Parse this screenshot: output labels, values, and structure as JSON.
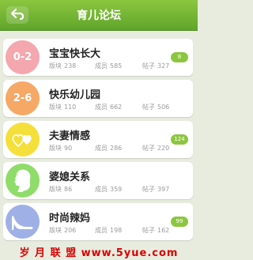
{
  "header": {
    "title": "育儿论坛"
  },
  "forums": [
    {
      "icon": "bubble-0-2-icon",
      "icon_text": "0-2",
      "color": "#f4a7ae",
      "name": "宝宝快长大",
      "stats": [
        {
          "label": "版块",
          "value": "238"
        },
        {
          "label": "成员",
          "value": "585"
        },
        {
          "label": "帖子",
          "value": "327"
        }
      ],
      "count": "8"
    },
    {
      "icon": "bubble-2-6-icon",
      "icon_text": "2-6",
      "color": "#f6a866",
      "name": "快乐幼儿园",
      "stats": [
        {
          "label": "版块",
          "value": "110"
        },
        {
          "label": "成员",
          "value": "662"
        },
        {
          "label": "帖子",
          "value": "506"
        }
      ],
      "count": ""
    },
    {
      "icon": "hearts-icon",
      "icon_text": "",
      "color": "#f5df3a",
      "name": "夫妻情感",
      "stats": [
        {
          "label": "版块",
          "value": "90"
        },
        {
          "label": "成员",
          "value": "286"
        },
        {
          "label": "帖子",
          "value": "220"
        }
      ],
      "count": "124"
    },
    {
      "icon": "woman-profile-icon",
      "icon_text": "",
      "color": "#8fdc6a",
      "name": "婆媳关系",
      "stats": [
        {
          "label": "版块",
          "value": "86"
        },
        {
          "label": "成员",
          "value": "359"
        },
        {
          "label": "帖子",
          "value": "397"
        }
      ],
      "count": ""
    },
    {
      "icon": "high-heel-icon",
      "icon_text": "",
      "color": "#9fb0e6",
      "name": "时尚辣妈",
      "stats": [
        {
          "label": "版块",
          "value": "206"
        },
        {
          "label": "成员",
          "value": "198"
        },
        {
          "label": "帖子",
          "value": "162"
        }
      ],
      "count": "99"
    }
  ],
  "watermark": "岁 月 联 盟 www.5yue.com"
}
